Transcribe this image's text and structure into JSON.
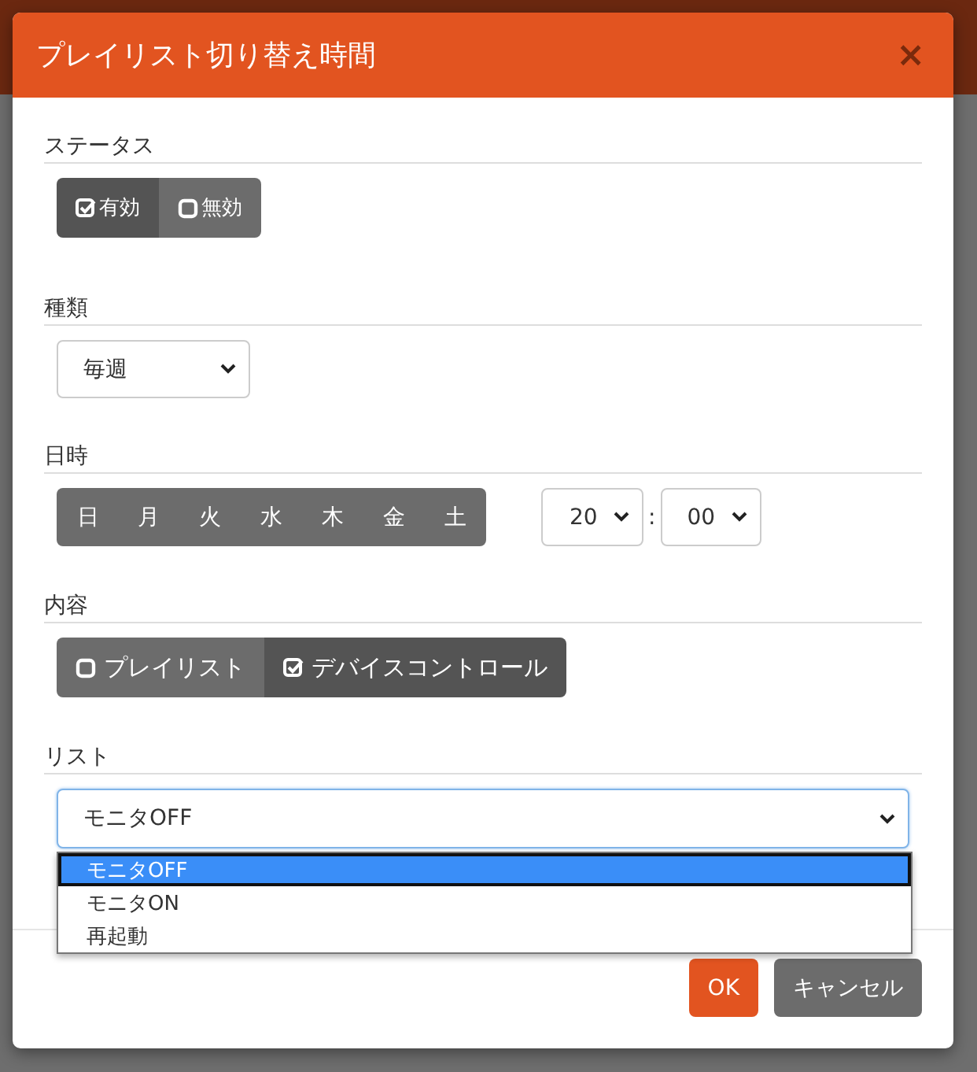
{
  "dialog": {
    "title": "プレイリスト切り替え時間",
    "close": "×"
  },
  "status": {
    "label": "ステータス",
    "options": [
      {
        "label": "有効",
        "selected": true
      },
      {
        "label": "無効",
        "selected": false
      }
    ]
  },
  "type": {
    "label": "種類",
    "value": "毎週"
  },
  "datetime": {
    "label": "日時",
    "days": [
      {
        "label": "日",
        "selected": false
      },
      {
        "label": "月",
        "selected": false
      },
      {
        "label": "火",
        "selected": false
      },
      {
        "label": "水",
        "selected": false
      },
      {
        "label": "木",
        "selected": false
      },
      {
        "label": "金",
        "selected": false
      },
      {
        "label": "土",
        "selected": false
      }
    ],
    "hour": "20",
    "separator": ":",
    "minute": "00"
  },
  "content": {
    "label": "内容",
    "options": [
      {
        "label": "プレイリスト",
        "selected": false
      },
      {
        "label": "デバイスコントロール",
        "selected": true
      }
    ]
  },
  "list": {
    "label": "リスト",
    "value": "モニタOFF",
    "expanded": true,
    "options": [
      {
        "label": "モニタOFF",
        "selected": true
      },
      {
        "label": "モニタON",
        "selected": false
      },
      {
        "label": "再起動",
        "selected": false
      }
    ]
  },
  "buttons": [
    {
      "label": "OK",
      "kind": "primary"
    },
    {
      "label": "キャンセル",
      "kind": "secondary"
    }
  ]
}
